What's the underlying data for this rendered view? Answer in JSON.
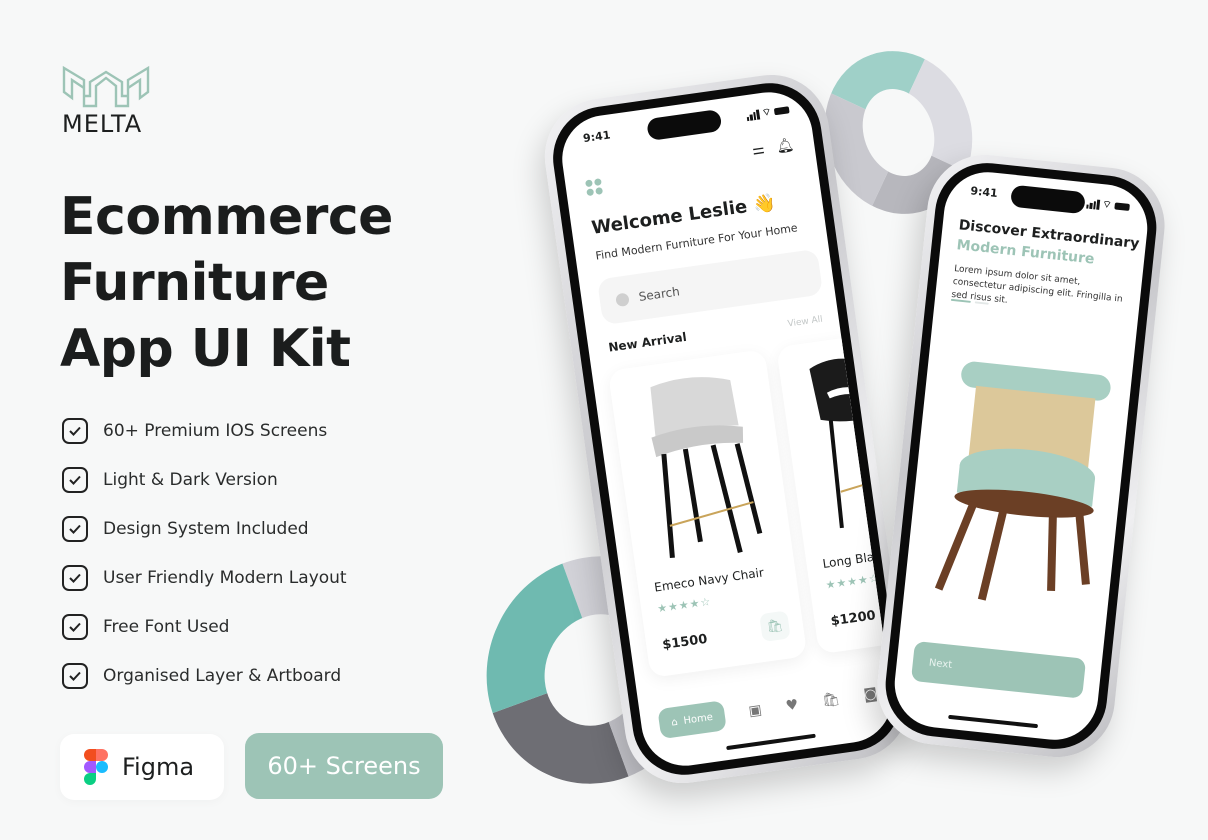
{
  "brand": {
    "name": "MELTA"
  },
  "headline": {
    "line1": "Ecommerce",
    "line2": "Furniture",
    "line3": "App UI Kit"
  },
  "features": [
    "60+ Premium IOS Screens",
    "Light & Dark Version",
    "Design System Included",
    "User Friendly Modern Layout",
    "Free Font Used",
    "Organised Layer & Artboard"
  ],
  "badges": {
    "figma": "Figma",
    "screens": "60+ Screens"
  },
  "colors": {
    "accent": "#9dc4b6",
    "text": "#1d1f1f",
    "background": "#f7f8f8"
  },
  "phone_home": {
    "time": "9:41",
    "welcome": "Welcome Leslie 👋",
    "subtitle": "Find Modern Furniture For Your Home",
    "search_placeholder": "Search",
    "section_title": "New Arrival",
    "view_all": "View All",
    "products": [
      {
        "name": "Emeco Navy Chair",
        "rating": 4,
        "stars": "★★★★☆",
        "price": "$1500"
      },
      {
        "name": "Long Black Chair",
        "rating": 4,
        "stars": "★★★★☆",
        "price": "$1200"
      }
    ],
    "nav": {
      "home": "Home",
      "icons": [
        "box-icon",
        "heart-icon",
        "bag-icon",
        "profile-icon"
      ]
    }
  },
  "phone_onboarding": {
    "time": "9:41",
    "title": "Discover Extraordinary",
    "subtitle": "Modern Furniture",
    "description": "Lorem ipsum dolor sit amet, consectetur adipiscing elit. Fringilla in sed risus sit.",
    "next_label": "Next"
  }
}
